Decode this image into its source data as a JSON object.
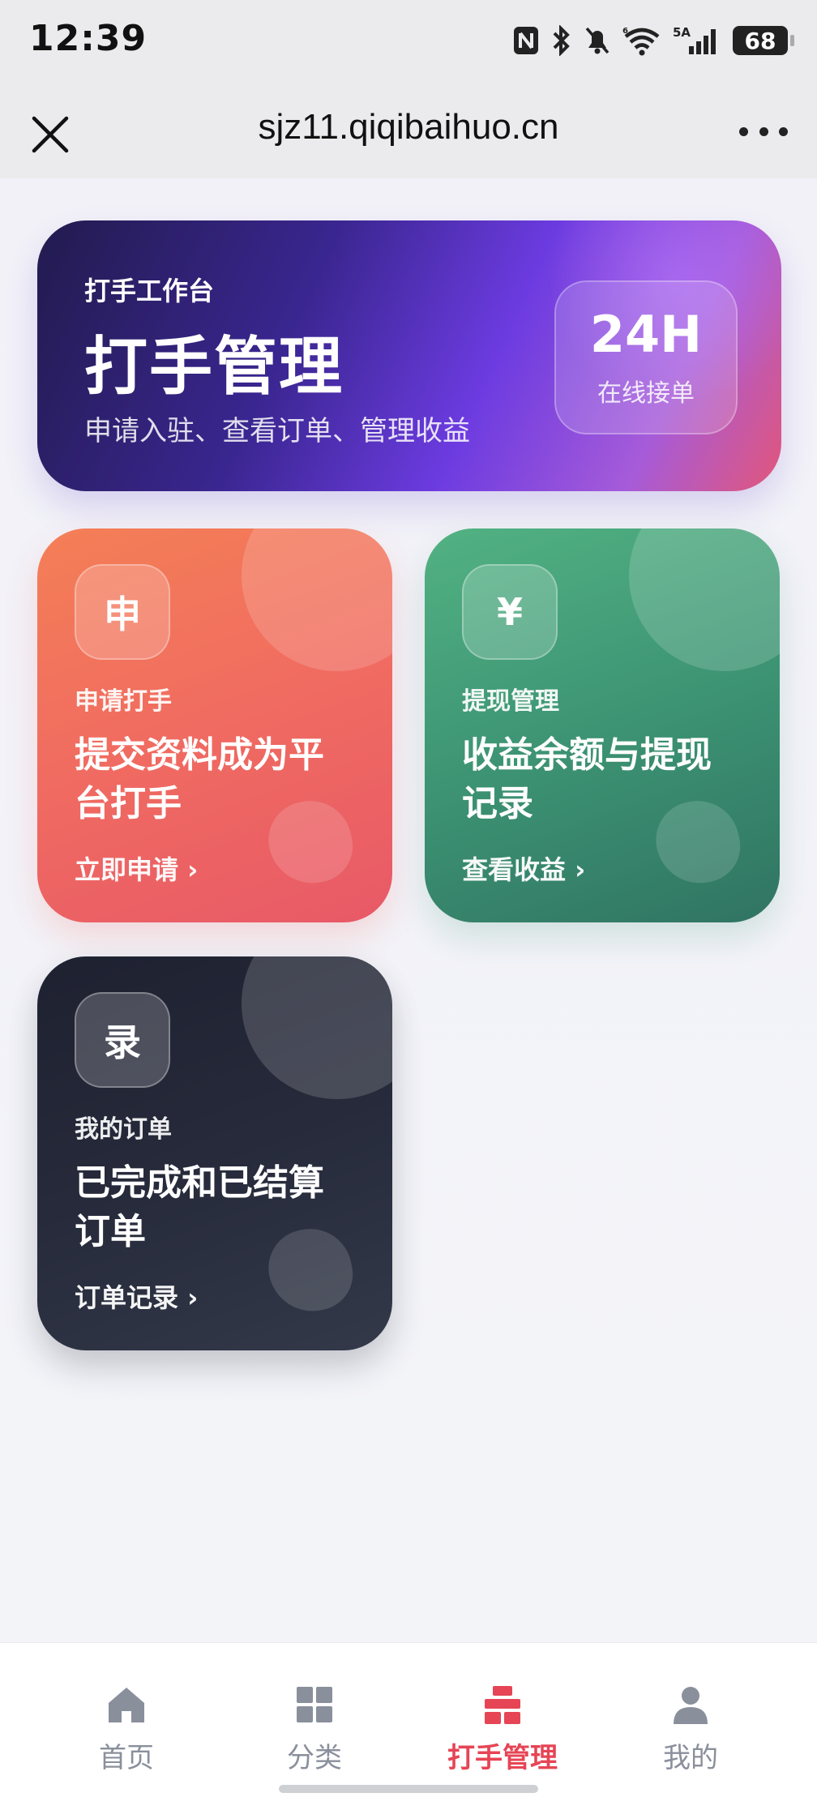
{
  "status_bar": {
    "time": "12:39",
    "icons": [
      "nfc-icon",
      "bluetooth-icon",
      "bell-muted-icon",
      "wifi-icon",
      "signal-icon"
    ],
    "network_label": "5A",
    "battery": "68"
  },
  "browser": {
    "url": "sjz11.qiqibaihuo.cn",
    "close_icon": "close-icon",
    "more_icon": "more-icon"
  },
  "hero": {
    "subtitle": "打手工作台",
    "title": "打手管理",
    "description": "申请入驻、查看订单、管理收益",
    "badge_big": "24H",
    "badge_small": "在线接单"
  },
  "tiles": [
    {
      "icon_char": "申",
      "label": "申请打手",
      "description": "提交资料成为平台打手",
      "link": "立即申请 ›",
      "color": "#f06b61"
    },
    {
      "icon_char": "¥",
      "label": "提现管理",
      "description": "收益余额与提现记录",
      "link": "查看收益 ›",
      "color": "#3d9474"
    },
    {
      "icon_char": "录",
      "label": "我的订单",
      "description": "已完成和已结算订单",
      "link": "订单记录 ›",
      "color": "#262a3a"
    }
  ],
  "tabbar": {
    "items": [
      {
        "label": "首页",
        "icon": "home-icon",
        "active": false
      },
      {
        "label": "分类",
        "icon": "grid-icon",
        "active": false
      },
      {
        "label": "打手管理",
        "icon": "manage-icon",
        "active": true
      },
      {
        "label": "我的",
        "icon": "user-icon",
        "active": false
      }
    ],
    "active_color": "#e64555",
    "inactive_color": "#8a8f9c"
  }
}
